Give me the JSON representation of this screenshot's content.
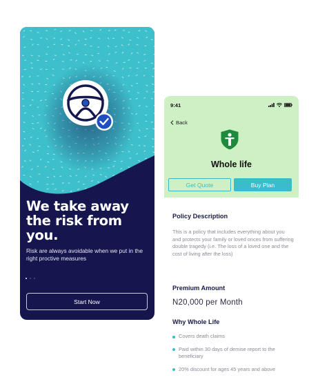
{
  "onboarding": {
    "title": "We take away the risk from you.",
    "description": "Risk are always avoidable when we put in the right proctive measures",
    "page_count": 3,
    "active_page": 1,
    "start_button": "Start Now",
    "icons": [
      "steering-wheel-icon",
      "check-badge-icon"
    ],
    "colors": {
      "teal": "#3ec0cc",
      "navy": "#16164f"
    }
  },
  "policy_screen": {
    "status_time": "9:41",
    "back_label": "Back",
    "icon": "shield-person-icon",
    "title": "Whole life",
    "get_quote_button": "Get Quote",
    "buy_plan_button": "Buy Plan",
    "policy_description_heading": "Policy Description",
    "policy_description_text": "This is a policy that includes everything about you and protects your family or loved onces from suffering double tragedy (i.e. The loss of a loved one and the cost of living after the loss)",
    "premium_heading": "Premium Amount",
    "premium_value": "N20,000 per Month",
    "why_heading": "Why Whole Life",
    "benefits": [
      "Covers death claims",
      "Paid within 30 days of demise report to the beneficiary",
      "20% discount for ages 45 years and above"
    ],
    "colors": {
      "header_bg": "#cdf0c4",
      "accent": "#3abccb",
      "shield": "#1e8a3c"
    }
  }
}
